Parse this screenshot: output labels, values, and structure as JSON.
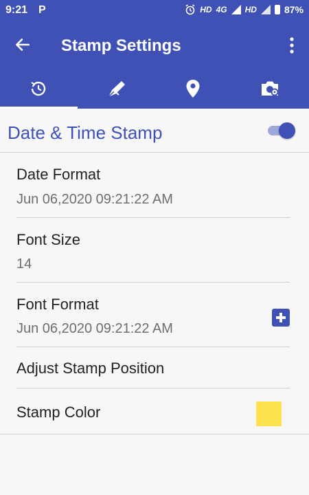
{
  "status_bar": {
    "time": "9:21",
    "notification_icon": "P",
    "net1": "HD",
    "net2": "4G",
    "net3": "HD",
    "battery": "87%"
  },
  "app_bar": {
    "title": "Stamp Settings",
    "back_icon": "arrow-left-icon",
    "menu_icon": "more-vert-icon"
  },
  "tabs": [
    {
      "icon": "clock-refresh-icon",
      "active": true
    },
    {
      "icon": "pen-nib-icon",
      "active": false
    },
    {
      "icon": "location-pin-icon",
      "active": false
    },
    {
      "icon": "camera-settings-icon",
      "active": false
    }
  ],
  "section": {
    "title": "Date & Time Stamp",
    "enabled": true
  },
  "settings": {
    "date_format": {
      "title": "Date Format",
      "value": "Jun 06,2020 09:21:22 AM"
    },
    "font_size": {
      "title": "Font Size",
      "value": "14"
    },
    "font_format": {
      "title": "Font Format",
      "value": "Jun 06,2020 09:21:22 AM"
    },
    "adjust_position": {
      "title": "Adjust Stamp Position"
    },
    "stamp_color": {
      "title": "Stamp Color",
      "color": "#fde24f"
    }
  },
  "colors": {
    "primary": "#3f51b5",
    "primary_light": "#9fa8da"
  }
}
